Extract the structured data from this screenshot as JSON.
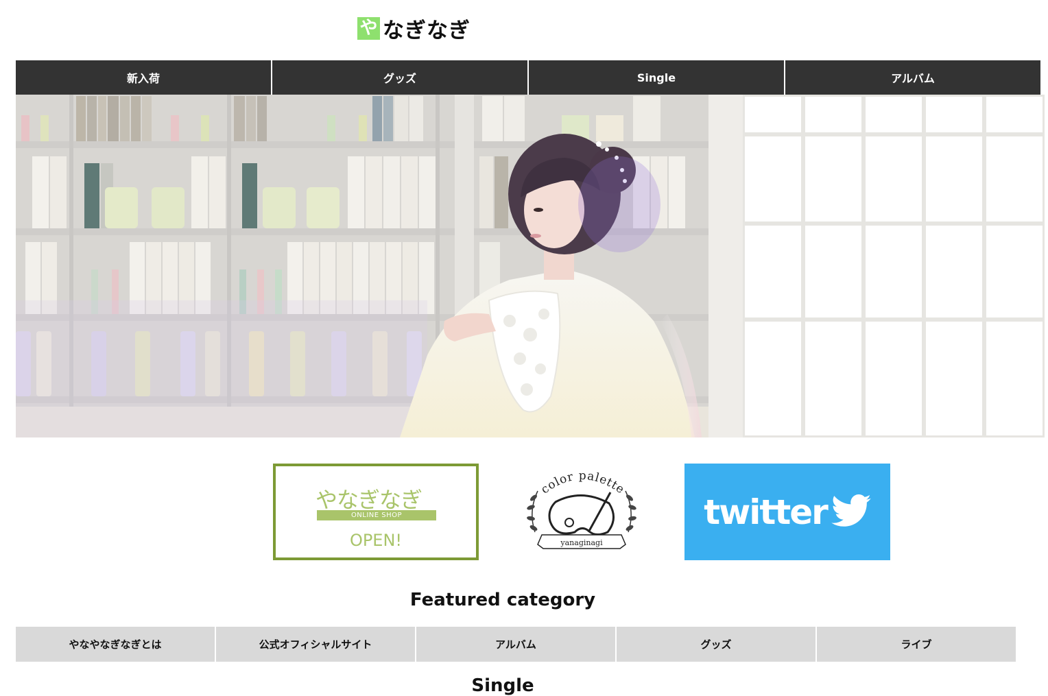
{
  "header": {
    "logo_mark": "や",
    "logo_text": "なぎなぎ",
    "accent_color": "#8ee06e"
  },
  "topnav": {
    "items": [
      {
        "label": "新入荷"
      },
      {
        "label": "グッズ"
      },
      {
        "label": "Single"
      },
      {
        "label": "アルバム"
      }
    ],
    "background": "#333333"
  },
  "hero": {
    "image": "photo of woman in white lace blouse in front of bookshelves and bright window"
  },
  "banners": {
    "shop": {
      "title": "やなぎなぎ",
      "bar_text": "ONLINE SHOP",
      "status": "OPEN!",
      "border_color": "#7d9a35",
      "text_color": "#a9c46a"
    },
    "palette": {
      "top_text": "color palette",
      "bottom_text": "yanaginagi"
    },
    "twitter": {
      "word": "twitter",
      "background": "#3aaff0"
    }
  },
  "featured": {
    "heading": "Featured category",
    "items": [
      {
        "label": "やなやなぎなぎとは"
      },
      {
        "label": "公式オフィシャルサイト"
      },
      {
        "label": "アルバム"
      },
      {
        "label": "グッズ"
      },
      {
        "label": "ライブ"
      }
    ],
    "background": "#d9d9d9"
  },
  "next_section": {
    "heading": "Single"
  }
}
